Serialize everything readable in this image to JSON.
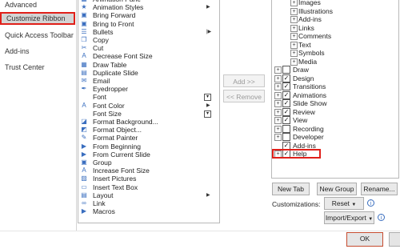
{
  "nav": {
    "items": [
      {
        "label": "Advanced",
        "selected": false
      },
      {
        "label": "Customize Ribbon",
        "selected": true
      },
      {
        "label": "Quick Access Toolbar",
        "selected": false
      },
      {
        "label": "Add-ins",
        "selected": false
      },
      {
        "label": "Trust Center",
        "selected": false
      }
    ]
  },
  "commands": [
    {
      "icon": "animation-pane-icon",
      "glyph": "▦",
      "label": "Animation Pane",
      "extra": ""
    },
    {
      "icon": "animation-styles-icon",
      "glyph": "★",
      "label": "Animation Styles",
      "extra": "arrow"
    },
    {
      "icon": "bring-forward-icon",
      "glyph": "▣",
      "label": "Bring Forward",
      "extra": ""
    },
    {
      "icon": "bring-to-front-icon",
      "glyph": "▣",
      "label": "Bring to Front",
      "extra": ""
    },
    {
      "icon": "bullets-icon",
      "glyph": "☰",
      "label": "Bullets",
      "extra": "bar"
    },
    {
      "icon": "copy-icon",
      "glyph": "❐",
      "label": "Copy",
      "extra": ""
    },
    {
      "icon": "cut-icon",
      "glyph": "✂",
      "label": "Cut",
      "extra": ""
    },
    {
      "icon": "decrease-font-size-icon",
      "glyph": "A",
      "label": "Decrease Font Size",
      "extra": ""
    },
    {
      "icon": "draw-table-icon",
      "glyph": "▦",
      "label": "Draw Table",
      "extra": ""
    },
    {
      "icon": "duplicate-slide-icon",
      "glyph": "▤",
      "label": "Duplicate Slide",
      "extra": ""
    },
    {
      "icon": "email-icon",
      "glyph": "✉",
      "label": "Email",
      "extra": ""
    },
    {
      "icon": "eyedropper-icon",
      "glyph": "✒",
      "label": "Eyedropper",
      "extra": ""
    },
    {
      "icon": "font-icon",
      "glyph": "",
      "label": "Font",
      "extra": "box"
    },
    {
      "icon": "font-color-icon",
      "glyph": "A",
      "label": "Font Color",
      "extra": "arrow"
    },
    {
      "icon": "font-size-icon",
      "glyph": "",
      "label": "Font Size",
      "extra": "box"
    },
    {
      "icon": "format-background-icon",
      "glyph": "◪",
      "label": "Format Background...",
      "extra": ""
    },
    {
      "icon": "format-object-icon",
      "glyph": "◩",
      "label": "Format Object...",
      "extra": ""
    },
    {
      "icon": "format-painter-icon",
      "glyph": "✎",
      "label": "Format Painter",
      "extra": ""
    },
    {
      "icon": "from-beginning-icon",
      "glyph": "▶",
      "label": "From Beginning",
      "extra": ""
    },
    {
      "icon": "from-current-slide-icon",
      "glyph": "▶",
      "label": "From Current Slide",
      "extra": ""
    },
    {
      "icon": "group-icon",
      "glyph": "▣",
      "label": "Group",
      "extra": ""
    },
    {
      "icon": "increase-font-size-icon",
      "glyph": "A",
      "label": "Increase Font Size",
      "extra": ""
    },
    {
      "icon": "insert-pictures-icon",
      "glyph": "▨",
      "label": "Insert Pictures",
      "extra": ""
    },
    {
      "icon": "insert-text-box-icon",
      "glyph": "▭",
      "label": "Insert Text Box",
      "extra": ""
    },
    {
      "icon": "layout-icon",
      "glyph": "▤",
      "label": "Layout",
      "extra": "arrow"
    },
    {
      "icon": "link-icon",
      "glyph": "∞",
      "label": "Link",
      "extra": ""
    },
    {
      "icon": "macros-icon",
      "glyph": "▶",
      "label": "Macros",
      "extra": ""
    }
  ],
  "mid": {
    "add": "Add >>",
    "remove": "<< Remove"
  },
  "tree": [
    {
      "label": "Images",
      "level": 2,
      "checkbox": false,
      "checked": false
    },
    {
      "label": "Illustrations",
      "level": 2,
      "checkbox": false,
      "checked": false
    },
    {
      "label": "Add-ins",
      "level": 2,
      "checkbox": false,
      "checked": false
    },
    {
      "label": "Links",
      "level": 2,
      "checkbox": false,
      "checked": false
    },
    {
      "label": "Comments",
      "level": 2,
      "checkbox": false,
      "checked": false
    },
    {
      "label": "Text",
      "level": 2,
      "checkbox": false,
      "checked": false
    },
    {
      "label": "Symbols",
      "level": 2,
      "checkbox": false,
      "checked": false
    },
    {
      "label": "Media",
      "level": 2,
      "checkbox": false,
      "checked": false
    },
    {
      "label": "Draw",
      "level": 1,
      "checkbox": true,
      "checked": false
    },
    {
      "label": "Design",
      "level": 1,
      "checkbox": true,
      "checked": true
    },
    {
      "label": "Transitions",
      "level": 1,
      "checkbox": true,
      "checked": true
    },
    {
      "label": "Animations",
      "level": 1,
      "checkbox": true,
      "checked": true
    },
    {
      "label": "Slide Show",
      "level": 1,
      "checkbox": true,
      "checked": true
    },
    {
      "label": "Review",
      "level": 1,
      "checkbox": true,
      "checked": true
    },
    {
      "label": "View",
      "level": 1,
      "checkbox": true,
      "checked": true
    },
    {
      "label": "Recording",
      "level": 1,
      "checkbox": true,
      "checked": false
    },
    {
      "label": "Developer",
      "level": 1,
      "checkbox": true,
      "checked": false
    },
    {
      "label": "Add-ins",
      "level": 1,
      "checkbox": true,
      "checked": true,
      "noexp": true
    },
    {
      "label": "Help",
      "level": 1,
      "checkbox": true,
      "checked": true
    }
  ],
  "buttons": {
    "new_tab": "New Tab",
    "new_group": "New Group",
    "rename": "Rename...",
    "customizations_label": "Customizations:",
    "reset": "Reset",
    "import_export": "Import/Export",
    "ok": "OK"
  },
  "colors": {
    "highlight_border": "#e0201a",
    "icon_blue": "#3a6ebf"
  }
}
